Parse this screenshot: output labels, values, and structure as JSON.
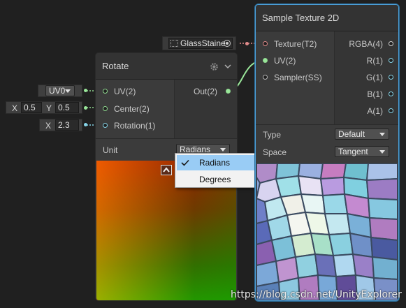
{
  "rotate_node": {
    "title": "Rotate",
    "inputs": [
      "UV(2)",
      "Center(2)",
      "Rotation(1)"
    ],
    "output": "Out(2)",
    "unit_label": "Unit",
    "unit_value": "Radians"
  },
  "unit_menu": {
    "options": [
      {
        "label": "Radians",
        "selected": true
      },
      {
        "label": "Degrees",
        "selected": false
      }
    ]
  },
  "uv_field": {
    "value": "UV0"
  },
  "center_field": {
    "x_label": "X",
    "x": "0.5",
    "y_label": "Y",
    "y": "0.5"
  },
  "rotation_field": {
    "x_label": "X",
    "x": "2.3"
  },
  "texture_field": {
    "value": "GlassStaine"
  },
  "sample_node": {
    "title": "Sample Texture 2D",
    "inputs": [
      "Texture(T2)",
      "UV(2)",
      "Sampler(SS)"
    ],
    "outputs": [
      "RGBA(4)",
      "R(1)",
      "G(1)",
      "B(1)",
      "A(1)"
    ],
    "type_label": "Type",
    "type_value": "Default",
    "space_label": "Space",
    "space_value": "Tangent"
  },
  "watermark": "https://blog.csdn.net/UnityExplorer",
  "colors": {
    "selection": "#4b9fd8",
    "green_port": "#9ae79a",
    "cyan_port": "#86d4e8",
    "red_port": "#e08a8a",
    "menu_highlight": "#99ccf5"
  },
  "icons": [
    "gear-icon",
    "chevron-down-icon",
    "checkmark-icon",
    "collapse-up-icon",
    "texture-icon",
    "object-picker-icon"
  ]
}
